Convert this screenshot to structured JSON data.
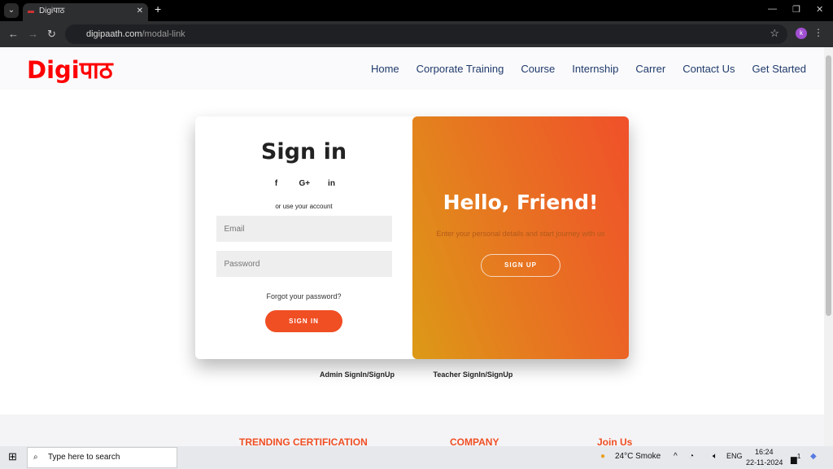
{
  "browser": {
    "tab_title": "Digiपाठ",
    "url_host": "digipaath.com",
    "url_path": "/modal-link",
    "profile_initial": "k"
  },
  "header": {
    "logo": "Digiपाठ",
    "menu": [
      "Home",
      "Corporate Training",
      "Course",
      "Internship",
      "Carrer",
      "Contact Us",
      "Get Started"
    ]
  },
  "signin": {
    "title": "Sign in",
    "social": [
      "f",
      "G+",
      "in"
    ],
    "or_text": "or use your account",
    "email_placeholder": "Email",
    "password_placeholder": "Password",
    "forgot": "Forgot your password?",
    "button": "SIGN IN"
  },
  "overlay": {
    "title": "Hello, Friend!",
    "text": "Enter your personal details and start journey with us",
    "button": "SIGN UP"
  },
  "links": {
    "admin": "Admin SignIn/SignUp",
    "teacher": "Teacher SignIn/SignUp"
  },
  "footer": {
    "headings": [
      "TRENDING CERTIFICATION",
      "COMPANY",
      "Join Us"
    ]
  },
  "taskbar": {
    "search": "Type here to search",
    "weather": "24°C  Smoke",
    "lang": "ENG",
    "time": "16:24",
    "date": "22-11-2024",
    "notifications": "1"
  },
  "colors": {
    "accent": "#f04e23",
    "logo": "#ff0000",
    "nav": "#1f3a6b"
  }
}
